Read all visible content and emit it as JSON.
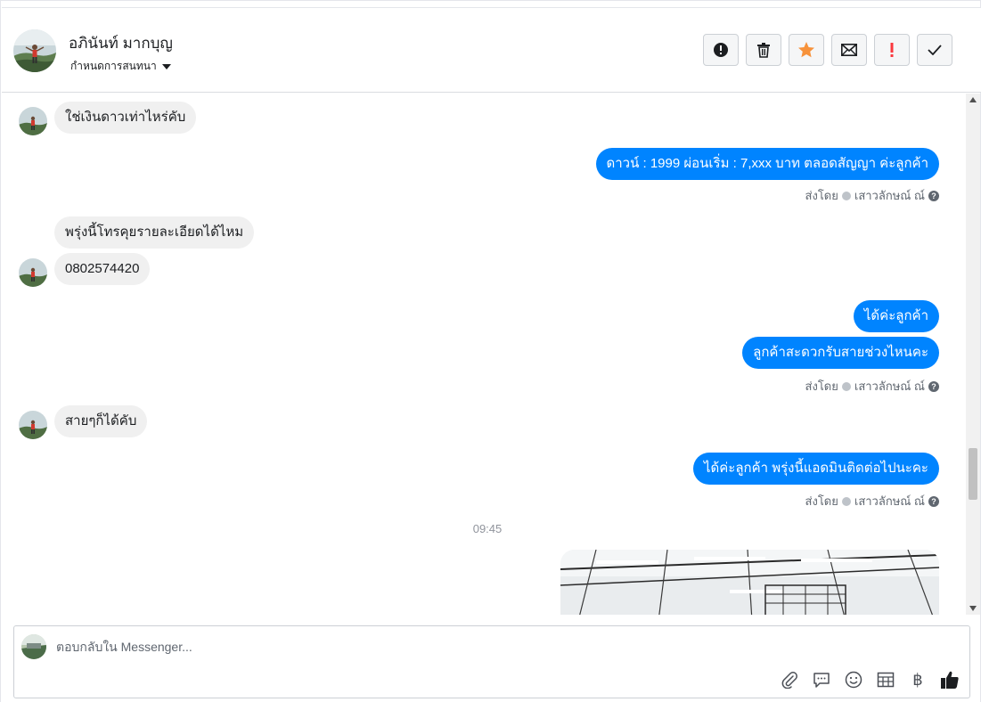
{
  "header": {
    "contact_name": "อภินันท์ มากบุญ",
    "assign_label": "กำหนดการสนทนา",
    "actions": [
      {
        "name": "spam-button",
        "icon": "alert-circle-icon"
      },
      {
        "name": "delete-button",
        "icon": "trash-icon"
      },
      {
        "name": "star-button",
        "icon": "star-icon"
      },
      {
        "name": "mark-unread-button",
        "icon": "envelope-icon"
      },
      {
        "name": "follow-up-button",
        "icon": "exclamation-icon"
      },
      {
        "name": "mark-done-button",
        "icon": "checkmark-icon"
      }
    ]
  },
  "messages": {
    "m1": "ใช่เงินดาวเท่าไหร่คับ",
    "m2": "ดาวน์ : 1999 ผ่อนเริ่ม : 7,xxx บาท ตลอดสัญญา ค่ะลูกค้า",
    "m3": "พรุ่งนี้โทรคุยรายละเอียดได้ไหม",
    "m4": "0802574420",
    "m5": "ได้ค่ะลูกค้า",
    "m6": "ลูกค้าสะดวกรับสายช่วงไหนคะ",
    "m7": "สายๆก็ได้คับ",
    "m8": "ได้ค่ะลูกค้า พรุ่งนี้แอดมินติดต่อไปนะคะ",
    "sent_by_prefix": "ส่งโดย",
    "sender_name": "เสาวลักษณ์ ณ์",
    "help_glyph": "?",
    "time_divider": "09:45"
  },
  "composer": {
    "placeholder": "ตอบกลับใน Messenger...",
    "tools": [
      "paperclip-icon",
      "saved-replies-icon",
      "emoji-icon",
      "table-icon",
      "baht-icon",
      "thumbs-up-icon"
    ],
    "baht_glyph": "฿"
  },
  "colors": {
    "outgoing_bubble": "#0084ff",
    "incoming_bubble": "#f0f0f0",
    "star": "#f7923b",
    "follow_up": "#fa383e"
  }
}
